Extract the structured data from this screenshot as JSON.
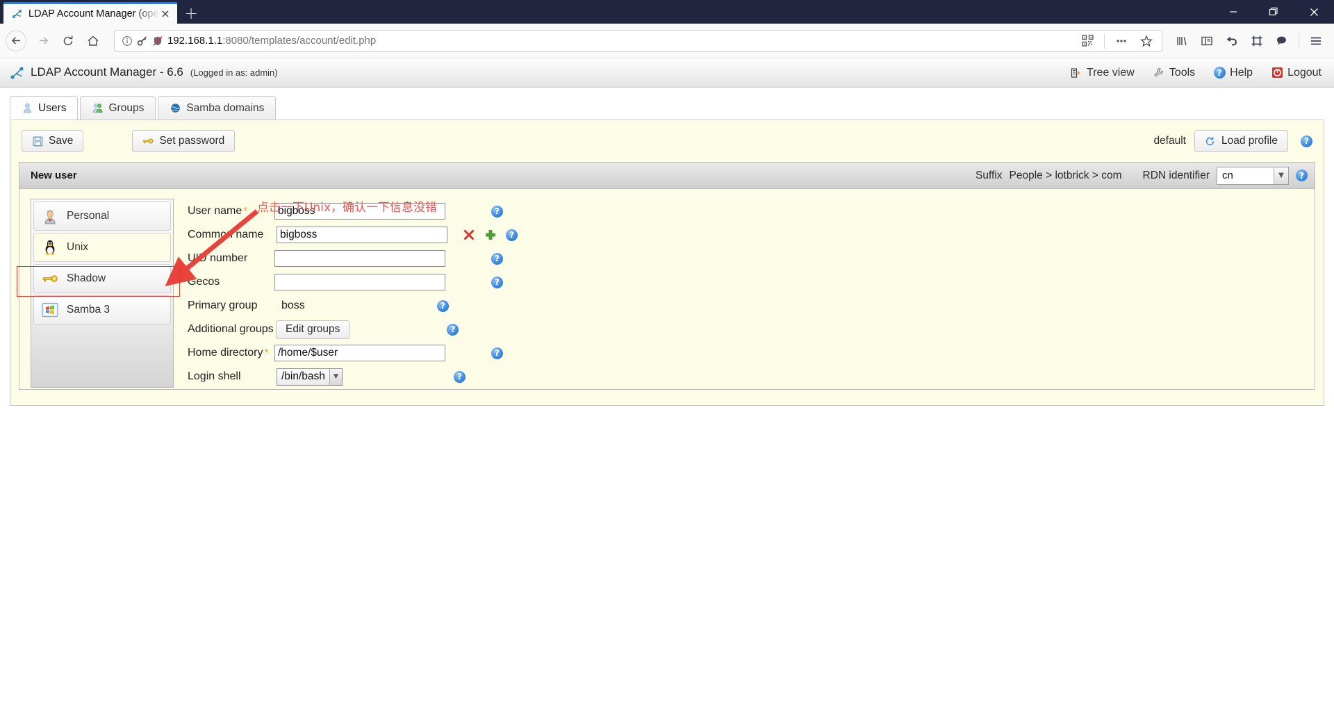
{
  "browser": {
    "tab": {
      "title": "LDAP Account Manager (ope",
      "close_label": "×",
      "favicon_name": "lam-favicon"
    },
    "newtab_label": "+",
    "window_controls": {
      "minimize": "─",
      "maximize": "❐",
      "close": "✕"
    },
    "nav": {
      "back": "←",
      "forward": "→",
      "reload": "↻",
      "home": "⌂"
    },
    "url": {
      "host": "192.168.1.1",
      "path": ":8080/templates/account/edit.php"
    },
    "urlbar_icons": [
      "info-icon",
      "key-icon",
      "shield-crossed-icon"
    ],
    "urlbar_right_icons": [
      "qr-code-icon",
      "page-actions-icon",
      "bookmark-star-icon"
    ],
    "toolbar_right_icons": [
      "library-icon",
      "sidebar-icon",
      "undo-icon",
      "screenshot-icon",
      "chat-icon",
      "hamburger-menu-icon"
    ]
  },
  "app": {
    "name": "LDAP Account Manager - 6.6",
    "login_info": "(Logged in as: admin)",
    "nav": [
      {
        "label": "Tree view",
        "icon": "tree-view-icon"
      },
      {
        "label": "Tools",
        "icon": "wrench-icon"
      },
      {
        "label": "Help",
        "icon": "help-icon"
      },
      {
        "label": "Logout",
        "icon": "logout-icon"
      }
    ]
  },
  "tabs": [
    {
      "label": "Users",
      "icon": "user-icon",
      "active": true
    },
    {
      "label": "Groups",
      "icon": "group-icon",
      "active": false
    },
    {
      "label": "Samba domains",
      "icon": "globe-icon",
      "active": false
    }
  ],
  "toolbar": {
    "save_label": "Save",
    "set_password_label": "Set password",
    "profile_name": "default",
    "load_profile_label": "Load profile",
    "help_label": "?"
  },
  "panel": {
    "title": "New user",
    "suffix_label": "Suffix",
    "suffix_value": "People > lotbrick > com",
    "rdn_label": "RDN identifier",
    "rdn_value": "cn",
    "help_label": "?"
  },
  "modules": [
    {
      "label": "Personal",
      "icon": "person-icon",
      "selected": false
    },
    {
      "label": "Unix",
      "icon": "tux-penguin-icon",
      "selected": true
    },
    {
      "label": "Shadow",
      "icon": "key-icon",
      "selected": false
    },
    {
      "label": "Samba 3",
      "icon": "windows-icon",
      "selected": false
    }
  ],
  "form": {
    "required_marker": "*",
    "help_label": "?",
    "fields": [
      {
        "label": "User name",
        "required": true,
        "type": "text",
        "value": "bigboss",
        "indent": false,
        "extra": []
      },
      {
        "label": "Common name",
        "required": false,
        "type": "text",
        "value": "bigboss",
        "indent": true,
        "extra": [
          "delete-icon",
          "add-icon"
        ]
      },
      {
        "label": "UID number",
        "required": false,
        "type": "text",
        "value": "",
        "indent": false,
        "extra": []
      },
      {
        "label": "Gecos",
        "required": false,
        "type": "text",
        "value": "",
        "indent": false,
        "extra": []
      },
      {
        "label": "Primary group",
        "required": false,
        "type": "static",
        "value": "boss",
        "indent": false,
        "extra": []
      },
      {
        "label": "Additional groups",
        "required": false,
        "type": "button",
        "value": "Edit groups",
        "indent": false,
        "extra": []
      },
      {
        "label": "Home directory",
        "required": true,
        "type": "text",
        "value": "/home/$user",
        "indent": false,
        "extra": []
      },
      {
        "label": "Login shell",
        "required": false,
        "type": "select",
        "value": "/bin/bash",
        "indent": false,
        "extra": []
      }
    ]
  },
  "annotation": {
    "text": "点击一下Unix，确认一下信息没错",
    "color": "#ea5a55"
  }
}
